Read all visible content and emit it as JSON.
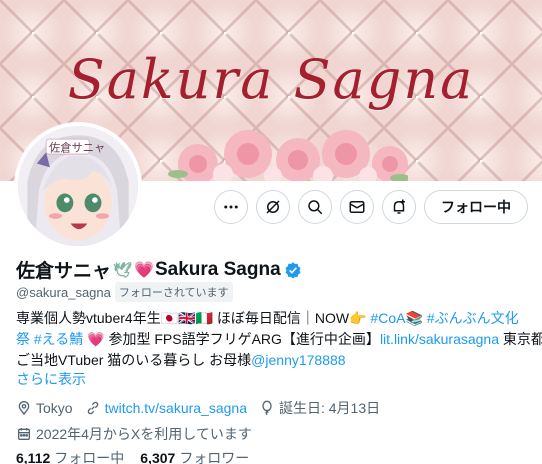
{
  "banner": {
    "title": "Sakura Sagna"
  },
  "actions": {
    "more_icon": "more-icon",
    "notify_off_icon": "notification-off-icon",
    "search_icon": "search-icon",
    "message_icon": "message-icon",
    "bell_icon": "bell-plus-icon",
    "follow_label": "フォロー中"
  },
  "profile": {
    "name_prefix": "佐倉サニャ",
    "name_suffix": "Sakura Sagna",
    "handle": "@sakura_sagna",
    "follows_you": "フォローされています",
    "bio": {
      "line1_text": "専業個人勢vtuber4年生🇯🇵🇬🇧🇮🇹 ほぼ毎日配信｜NOW👉 ",
      "line1_tag1": "#CoA",
      "line1_mid": "📚 ",
      "line1_tag2": "#ぶんぶん文化",
      "line2_tag": "祭 #える鯖",
      "line2_text": " 💗 参加型 FPS語学フリゲARG【進行中企画】",
      "line2_link": "lit.link/sakurasagna",
      "line2_end": " 東京都",
      "line3_text": "ご当地VTuber 猫のいる暮らし お母様",
      "line3_mention": "@jenny178888"
    },
    "show_more": "さらに表示",
    "location": "Tokyo",
    "website": "twitch.tv/sakura_sagna",
    "birthday": "誕生日: 4月13日",
    "joined": "2022年4月からXを利用しています",
    "following_count": "6,112",
    "following_label": "フォロー中",
    "followers_count": "6,307",
    "followers_label": "フォロワー"
  },
  "colors": {
    "accent": "#1d9bf0",
    "banner_text": "#a5202f",
    "muted": "#536471"
  }
}
